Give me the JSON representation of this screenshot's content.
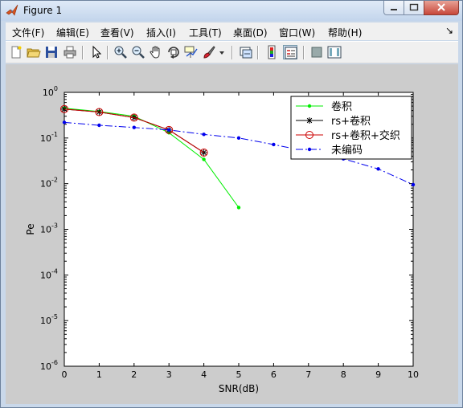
{
  "window": {
    "title": "Figure 1"
  },
  "menu": [
    "文件(F)",
    "编辑(E)",
    "查看(V)",
    "插入(I)",
    "工具(T)",
    "桌面(D)",
    "窗口(W)",
    "帮助(H)"
  ],
  "toolbar": [
    "new-figure-icon",
    "open-folder-icon",
    "save-icon",
    "print-icon",
    "pointer-icon",
    "zoom-in-icon",
    "zoom-out-icon",
    "pan-hand-icon",
    "rotate-3d-icon",
    "data-cursor-icon",
    "brush-icon",
    "link-icon",
    "colorbar-icon",
    "legend-icon",
    "hide-tools-icon",
    "show-tools-icon"
  ],
  "chart_data": {
    "type": "line",
    "xlabel": "SNR(dB)",
    "ylabel": "Pe",
    "xlim": [
      0,
      10
    ],
    "ylim": [
      1e-06,
      1
    ],
    "yscale": "log",
    "x_ticks": [
      "0",
      "1",
      "2",
      "3",
      "4",
      "5",
      "6",
      "7",
      "8",
      "9",
      "10"
    ],
    "y_ticks": [
      {
        "base": "10",
        "exp": "0"
      },
      {
        "base": "10",
        "exp": "-1"
      },
      {
        "base": "10",
        "exp": "-2"
      },
      {
        "base": "10",
        "exp": "-3"
      },
      {
        "base": "10",
        "exp": "-4"
      },
      {
        "base": "10",
        "exp": "-5"
      },
      {
        "base": "10",
        "exp": "-6"
      }
    ],
    "legend_position": "top-right",
    "series": [
      {
        "name": "卷积",
        "color": "#00ee00",
        "marker": "dot",
        "line": "solid",
        "x": [
          0,
          1,
          2,
          3,
          4,
          5
        ],
        "y": [
          0.45,
          0.38,
          0.3,
          0.13,
          0.034,
          0.003
        ]
      },
      {
        "name": "rs+卷积",
        "color": "#000000",
        "marker": "star",
        "line": "solid",
        "x": [
          0,
          1,
          2,
          3,
          4
        ],
        "y": [
          0.43,
          0.37,
          0.28,
          0.15,
          0.048
        ]
      },
      {
        "name": "rs+卷积+交织",
        "color": "#cc0000",
        "marker": "circle",
        "line": "solid",
        "x": [
          0,
          1,
          2,
          3,
          4
        ],
        "y": [
          0.43,
          0.37,
          0.28,
          0.15,
          0.048
        ]
      },
      {
        "name": "未编码",
        "color": "#0000ee",
        "marker": "dot",
        "line": "dashdot",
        "x": [
          0,
          1,
          2,
          3,
          4,
          5,
          6,
          7,
          8,
          9,
          10
        ],
        "y": [
          0.22,
          0.19,
          0.17,
          0.15,
          0.12,
          0.1,
          0.072,
          0.05,
          0.035,
          0.021,
          0.0095
        ]
      }
    ]
  }
}
